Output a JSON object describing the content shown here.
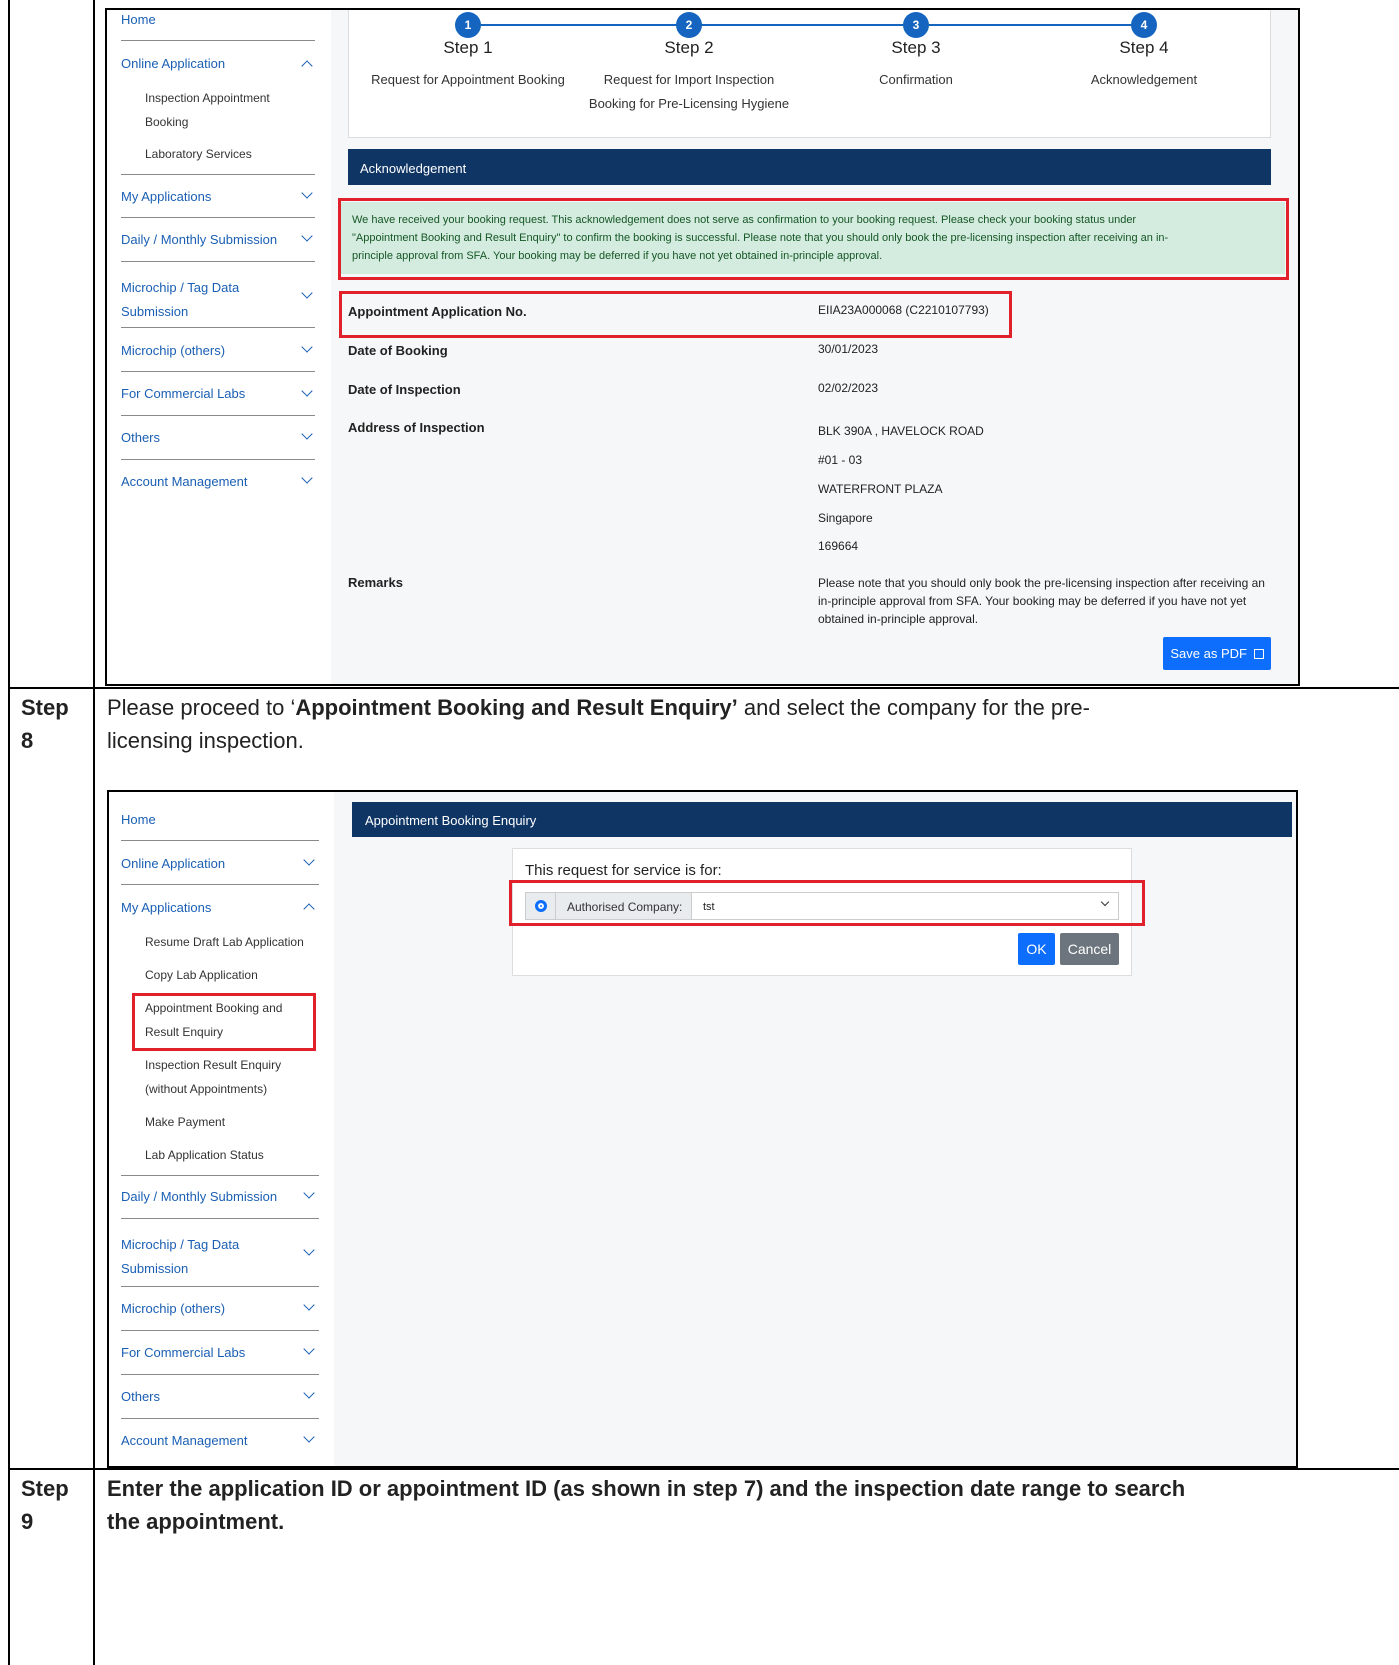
{
  "s1": {
    "nav": {
      "home": "Home",
      "online_application": "Online Application",
      "sub1_l1": "Inspection Appointment",
      "sub1_l2": "Booking",
      "sub2": "Laboratory Services",
      "my_applications": "My Applications",
      "daily": "Daily / Monthly Submission",
      "microchip_tag_l1": "Microchip / Tag Data",
      "microchip_tag_l2": "Submission",
      "microchip_others": "Microchip (others)",
      "commercial": "For Commercial Labs",
      "others": "Others",
      "account": "Account Management"
    },
    "steps": [
      {
        "num": "1",
        "title": "Step 1",
        "desc1": "Request for Appointment Booking",
        "desc2": ""
      },
      {
        "num": "2",
        "title": "Step 2",
        "desc1": "Request for Import Inspection",
        "desc2": "Booking for Pre-Licensing Hygiene"
      },
      {
        "num": "3",
        "title": "Step 3",
        "desc1": "Confirmation",
        "desc2": ""
      },
      {
        "num": "4",
        "title": "Step 4",
        "desc1": "Acknowledgement",
        "desc2": ""
      }
    ],
    "ack_header": "Acknowledgement",
    "alert_l1": "We have received your booking request. This acknowledgement does not serve as confirmation to your booking request. Please check your booking status under",
    "alert_l2": "\"Appointment Booking and Result Enquiry\" to confirm the booking is successful. Please note that you should only book the pre-licensing inspection after receiving an in-",
    "alert_l3": "principle approval from SFA. Your booking may be deferred if you have not yet obtained in-principle approval.",
    "fields": {
      "app_no_label": "Appointment Application No.",
      "app_no_value": "EIIA23A000068 (C2210107793)",
      "date_booking_label": "Date of Booking",
      "date_booking_value": "30/01/2023",
      "date_insp_label": "Date of Inspection",
      "date_insp_value": "02/02/2023",
      "address_label": "Address of Inspection",
      "addr1": "BLK 390A , HAVELOCK ROAD",
      "addr2": "#01 - 03",
      "addr3": "WATERFRONT PLAZA",
      "addr4": "Singapore",
      "addr5": "169664",
      "remarks_label": "Remarks",
      "remarks_l1": "Please note that you should only book the pre-licensing inspection after receiving an",
      "remarks_l2": "in-principle approval from SFA. Your booking may be deferred if you have not yet",
      "remarks_l3": "obtained in-principle approval."
    },
    "save_pdf": "Save as PDF"
  },
  "step8": {
    "label_l1": "Step",
    "label_l2": "8",
    "text_pre": "Please proceed to ‘",
    "text_bold": "Appointment Booking and Result Enquiry’",
    "text_post": " and select the company for the pre-",
    "text_l2": "licensing inspection."
  },
  "s2": {
    "nav": {
      "home": "Home",
      "online_application": "Online Application",
      "my_applications": "My Applications",
      "sub1": "Resume Draft Lab Application",
      "sub2": "Copy Lab Application",
      "sub3_l1": "Appointment Booking and",
      "sub3_l2": "Result Enquiry",
      "sub4_l1": "Inspection Result Enquiry",
      "sub4_l2": "(without Appointments)",
      "sub5": "Make Payment",
      "sub6": "Lab Application Status",
      "daily": "Daily / Monthly Submission",
      "microchip_tag_l1": "Microchip / Tag Data",
      "microchip_tag_l2": "Submission",
      "microchip_others": "Microchip (others)",
      "commercial": "For Commercial Labs",
      "others": "Others",
      "account": "Account Management"
    },
    "header": "Appointment Booking Enquiry",
    "question": "This request for service is for:",
    "company_label": "Authorised Company:",
    "company_value": "tst",
    "ok": "OK",
    "cancel": "Cancel"
  },
  "step9": {
    "label_l1": "Step",
    "label_l2": "9",
    "text_l1": "Enter the application ID or appointment ID (as shown in step 7) and the inspection date range to search",
    "text_l2": "the appointment."
  },
  "colors": {
    "link": "#1a5fb4",
    "navy_header": "#0f3565",
    "step_blue": "#1565c0",
    "alert_bg": "#d4ebdf",
    "highlight_red": "#e0202a",
    "button_blue": "#0d6efd",
    "button_grey": "#6c757d"
  }
}
